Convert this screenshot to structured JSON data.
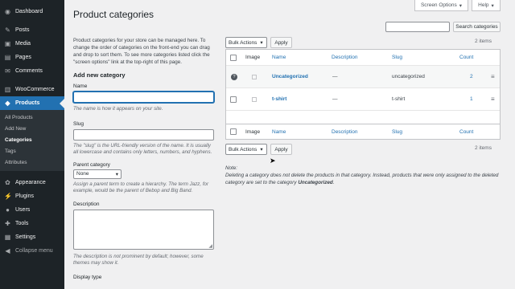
{
  "sidebar": {
    "items": [
      {
        "label": "Dashboard",
        "icon": "dashboard-icon",
        "glyph": "◉"
      },
      {
        "label": "Posts",
        "icon": "pin-icon",
        "glyph": "✎"
      },
      {
        "label": "Media",
        "icon": "media-icon",
        "glyph": "▣"
      },
      {
        "label": "Pages",
        "icon": "pages-icon",
        "glyph": "▤"
      },
      {
        "label": "Comments",
        "icon": "comments-icon",
        "glyph": "✉"
      },
      {
        "label": "WooCommerce",
        "icon": "woocommerce-icon",
        "glyph": "▥"
      },
      {
        "label": "Products",
        "icon": "products-icon",
        "glyph": "◆"
      }
    ],
    "submenu": [
      "All Products",
      "Add New",
      "Categories",
      "Tags",
      "Attributes"
    ],
    "bottom_items": [
      {
        "label": "Appearance",
        "icon": "appearance-icon",
        "glyph": "✿"
      },
      {
        "label": "Plugins",
        "icon": "plugins-icon",
        "glyph": "⚡"
      },
      {
        "label": "Users",
        "icon": "users-icon",
        "glyph": "●"
      },
      {
        "label": "Tools",
        "icon": "tools-icon",
        "glyph": "✚"
      },
      {
        "label": "Settings",
        "icon": "settings-icon",
        "glyph": "▦"
      },
      {
        "label": "Collapse menu",
        "icon": "collapse-icon",
        "glyph": "◀"
      }
    ]
  },
  "header": {
    "screen_options": "Screen Options",
    "help": "Help",
    "title": "Product categories"
  },
  "form": {
    "intro": "Product categories for your store can be managed here. To change the order of categories on the front-end you can drag and drop to sort them. To see more categories listed click the \"screen options\" link at the top-right of this page.",
    "heading": "Add new category",
    "name_label": "Name",
    "name_desc": "The name is how it appears on your site.",
    "slug_label": "Slug",
    "slug_desc": "The \"slug\" is the URL-friendly version of the name. It is usually all lowercase and contains only letters, numbers, and hyphens.",
    "parent_label": "Parent category",
    "parent_value": "None",
    "parent_desc": "Assign a parent term to create a hierarchy. The term Jazz, for example, would be the parent of Bebop and Big Band.",
    "description_label": "Description",
    "description_desc": "The description is not prominent by default; however, some themes may show it.",
    "display_type_label": "Display type"
  },
  "list": {
    "search_button": "Search categories",
    "bulk_actions": "Bulk Actions",
    "apply": "Apply",
    "item_count": "2 items",
    "columns": {
      "image": "Image",
      "name": "Name",
      "description": "Description",
      "slug": "Slug",
      "count": "Count"
    },
    "rows": [
      {
        "name": "Uncategorized",
        "description": "—",
        "slug": "uncategorized",
        "count": "2"
      },
      {
        "name": "t-shirt",
        "description": "—",
        "slug": "t-shirt",
        "count": "1"
      }
    ],
    "note_label": "Note:",
    "note_text": "Deleting a category does not delete the products in that category. Instead, products that were only assigned to the deleted category are set to the category ",
    "note_emph": "Uncategorized",
    "note_end": "."
  }
}
